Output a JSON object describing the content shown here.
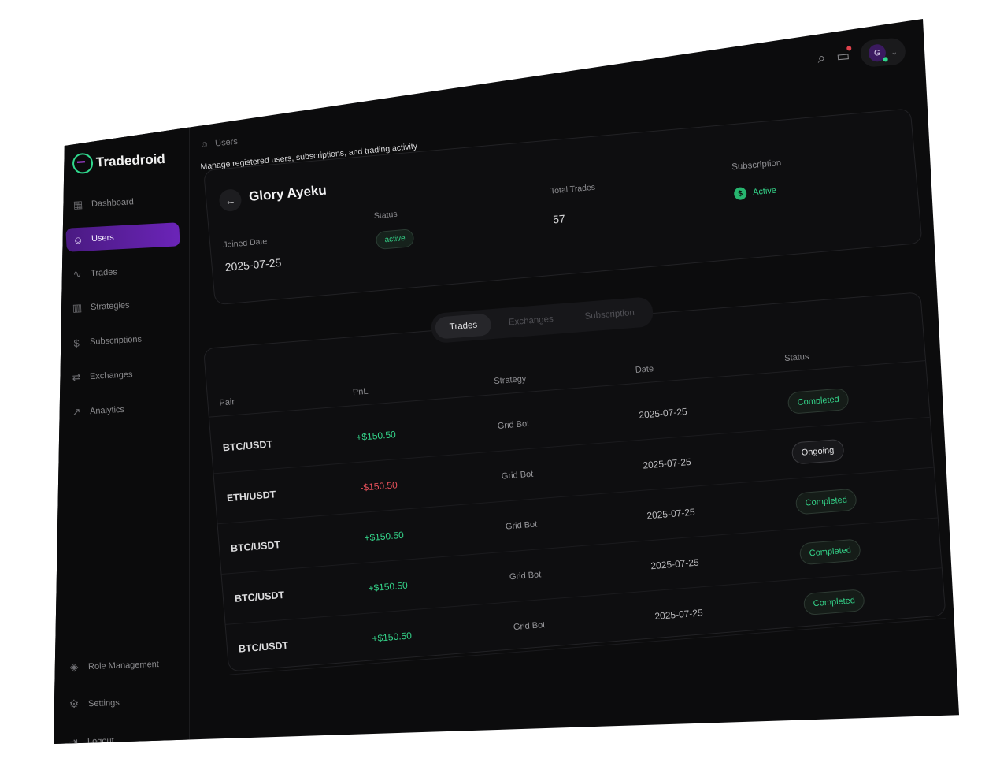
{
  "brand": {
    "name": "Tradedroid"
  },
  "sidebar": {
    "items": [
      {
        "label": "Dashboard",
        "icon": "dashboard-icon",
        "glyph": "▦",
        "active": false
      },
      {
        "label": "Users",
        "icon": "users-icon",
        "glyph": "☺",
        "active": true
      },
      {
        "label": "Trades",
        "icon": "activity-icon",
        "glyph": "∿",
        "active": false
      },
      {
        "label": "Strategies",
        "icon": "strategies-icon",
        "glyph": "▥",
        "active": false
      },
      {
        "label": "Subscriptions",
        "icon": "dollar-circle-icon",
        "glyph": "$",
        "active": false
      },
      {
        "label": "Exchanges",
        "icon": "exchange-icon",
        "glyph": "⇄",
        "active": false
      },
      {
        "label": "Analytics",
        "icon": "trend-up-icon",
        "glyph": "↗",
        "active": false
      }
    ],
    "bottom": [
      {
        "label": "Role Management",
        "icon": "diamond-icon",
        "glyph": "◈"
      },
      {
        "label": "Settings",
        "icon": "gear-icon",
        "glyph": "⚙"
      },
      {
        "label": "Logout",
        "icon": "logout-icon",
        "glyph": "⇥"
      }
    ]
  },
  "header": {
    "breadcrumb": "Users",
    "subtitle": "Manage registered users, subscriptions, and trading activity",
    "avatar_initial": "G"
  },
  "profile": {
    "name": "Glory Ayeku",
    "joined_label": "Joined Date",
    "joined_value": "2025-07-25",
    "status_label": "Status",
    "status_value": "active",
    "trades_label": "Total Trades",
    "trades_value": "57",
    "subscription_label": "Subscription",
    "subscription_value": "Active"
  },
  "tabs": [
    "Trades",
    "Exchanges",
    "Subscription"
  ],
  "table": {
    "headers": [
      "Pair",
      "PnL",
      "Strategy",
      "Date",
      "Status"
    ],
    "rows": [
      {
        "pair": "BTC/USDT",
        "pnl": "+$150.50",
        "positive": true,
        "strategy": "Grid Bot",
        "date": "2025-07-25",
        "status": "Completed"
      },
      {
        "pair": "ETH/USDT",
        "pnl": "-$150.50",
        "positive": false,
        "strategy": "Grid Bot",
        "date": "2025-07-25",
        "status": "Ongoing"
      },
      {
        "pair": "BTC/USDT",
        "pnl": "+$150.50",
        "positive": true,
        "strategy": "Grid Bot",
        "date": "2025-07-25",
        "status": "Completed"
      },
      {
        "pair": "BTC/USDT",
        "pnl": "+$150.50",
        "positive": true,
        "strategy": "Grid Bot",
        "date": "2025-07-25",
        "status": "Completed"
      },
      {
        "pair": "BTC/USDT",
        "pnl": "+$150.50",
        "positive": true,
        "strategy": "Grid Bot",
        "date": "2025-07-25",
        "status": "Completed"
      }
    ]
  },
  "colors": {
    "accent": "#6b24b8",
    "positive": "#34d389",
    "negative": "#e5505a",
    "background": "#0c0c0d"
  }
}
